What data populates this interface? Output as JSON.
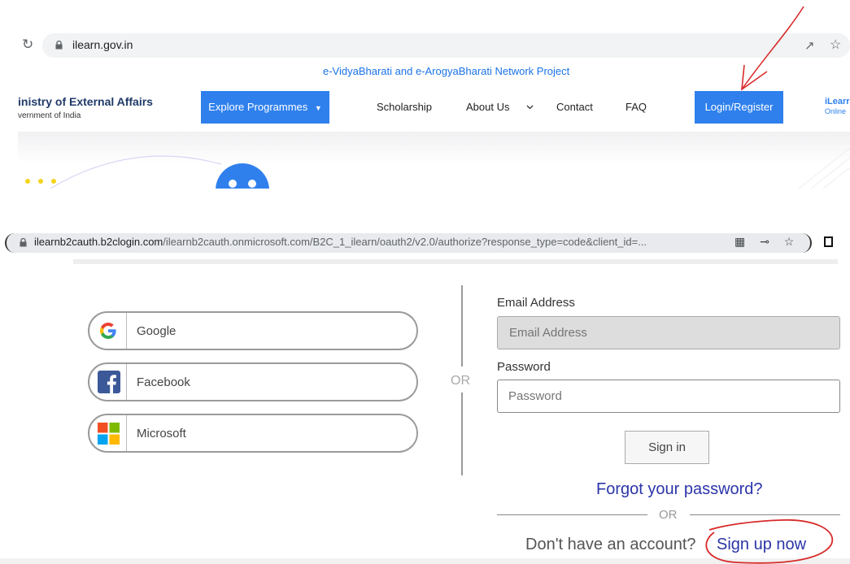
{
  "top_screenshot": {
    "browser": {
      "url": "ilearn.gov.in",
      "icons": [
        "reload-icon",
        "lock-icon",
        "share-icon",
        "star-icon"
      ]
    },
    "banner": "e-VidyaBharati and e-ArogyaBharati Network Project",
    "header": {
      "ministry": "inistry of External Affairs",
      "government": "vernment of India",
      "explore_button": "Explore Programmes",
      "nav": [
        "Scholarship",
        "About Us",
        "Contact",
        "FAQ"
      ],
      "login_button": "Login/Register",
      "brand": "iLearr",
      "brand_sub": "Online"
    }
  },
  "bottom_screenshot": {
    "browser": {
      "url_domain": "ilearnb2cauth.b2clogin.com",
      "url_path": "/ilearnb2cauth.onmicrosoft.com/B2C_1_ilearn/oauth2/v2.0/authorize?response_type=code&client_id=..."
    },
    "social_logins": [
      {
        "label": "Google",
        "icon": "google-icon"
      },
      {
        "label": "Facebook",
        "icon": "facebook-icon"
      },
      {
        "label": "Microsoft",
        "icon": "microsoft-icon"
      }
    ],
    "divider_or": "OR",
    "form": {
      "email_label": "Email Address",
      "email_placeholder": "Email Address",
      "password_label": "Password",
      "password_placeholder": "Password",
      "signin_button": "Sign in",
      "forgot_link": "Forgot your password?",
      "or_text": "OR",
      "no_account_text": "Don't have an account?",
      "signup_link": "Sign up now"
    }
  },
  "annotations": {
    "color": "#d92b2b",
    "arrow_target": "Login/Register",
    "circled": "Sign up now"
  }
}
